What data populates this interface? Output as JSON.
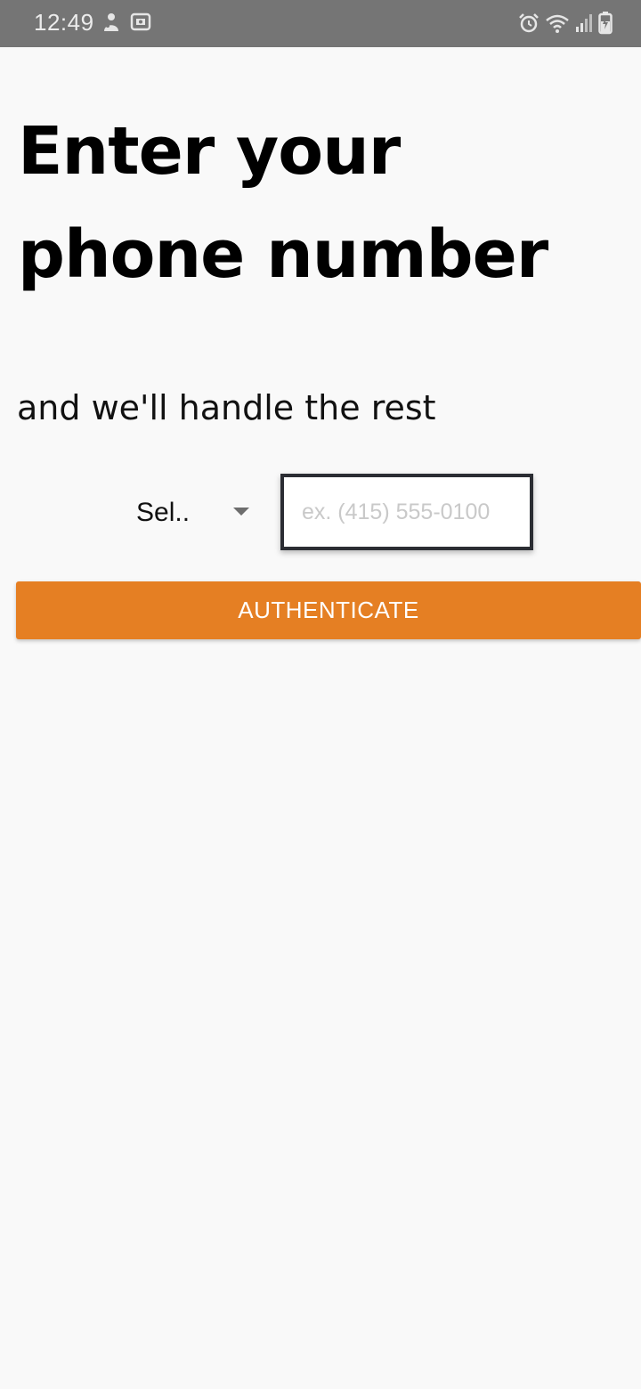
{
  "status_bar": {
    "time": "12:49",
    "left_icons": [
      "notification-app-icon",
      "screen-record-icon"
    ],
    "right_icons": [
      "alarm-icon",
      "wifi-icon",
      "cell-signal-icon",
      "battery-charging-icon"
    ],
    "background": "#757575"
  },
  "screen": {
    "title": "Enter your phone number",
    "subtitle": "and we'll handle the rest",
    "country_select": {
      "value": "Sel.."
    },
    "phone_input": {
      "value": "",
      "placeholder": "ex. (415) 555-0100"
    },
    "authenticate_label": "AUTHENTICATE"
  },
  "colors": {
    "accent": "#e57f23",
    "background": "#f9f9f9",
    "input_border": "#2b2d33"
  }
}
